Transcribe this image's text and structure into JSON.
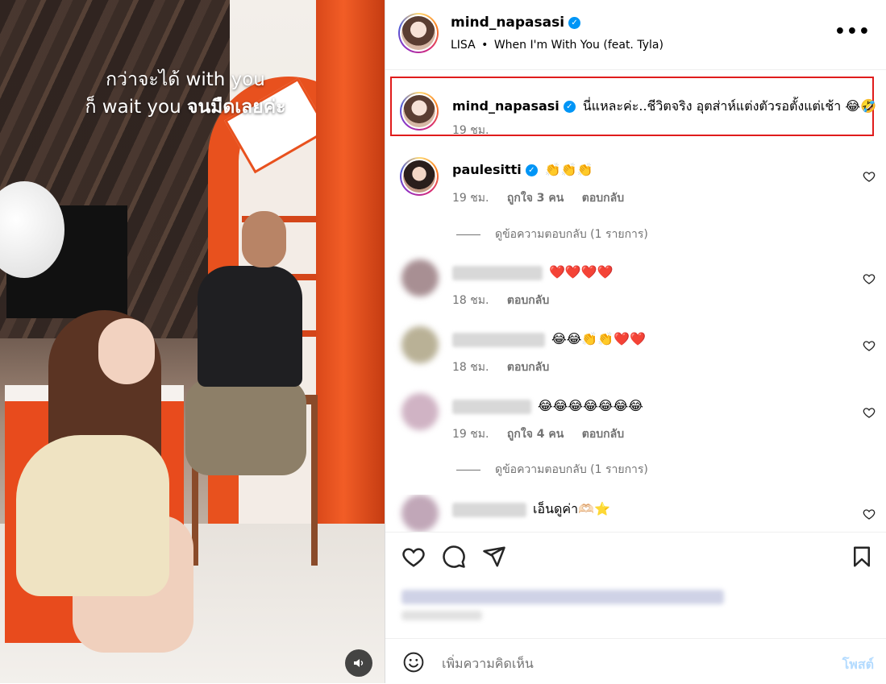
{
  "video": {
    "caption_line1": "กว่าจะได้ with you",
    "caption_line2_a": "ก็ wait you",
    "caption_line2_b": "จนมืดเลยค่ะ",
    "mute_icon": "speaker-icon"
  },
  "header": {
    "username": "mind_napasasi",
    "verified": true,
    "artist": "LISA",
    "separator": "•",
    "song": "When I'm With You (feat. Tyla)",
    "more_label": "•••"
  },
  "caption": {
    "username": "mind_napasasi",
    "text": "นี่แหละค่ะ..ชีวิตจริง อุตส่าห์แต่งตัวรอตั้งแต่เช้า 😂🤣",
    "time": "19 ชม."
  },
  "comments": [
    {
      "username": "paulesitti",
      "verified": true,
      "text": "👏👏👏",
      "time": "19 ชม.",
      "likes": "ถูกใจ 3 คน",
      "reply": "ตอบกลับ",
      "view_replies": "ดูข้อความตอบกลับ (1 รายการ)"
    },
    {
      "username_hidden": true,
      "text": "❤️❤️❤️❤️",
      "time": "18 ชม.",
      "reply": "ตอบกลับ"
    },
    {
      "username_hidden": true,
      "text": "😂😂👏👏❤️❤️",
      "time": "18 ชม.",
      "reply": "ตอบกลับ"
    },
    {
      "username_hidden": true,
      "text": "😂😂😂😂😂😂😂",
      "time": "19 ชม.",
      "likes": "ถูกใจ 4 คน",
      "reply": "ตอบกลับ",
      "view_replies": "ดูข้อความตอบกลับ (1 รายการ)"
    },
    {
      "username_hidden": true,
      "text": "เอ็นดูค่า🫶🏻⭐",
      "time": "",
      "reply": ""
    }
  ],
  "actions": {
    "like_icon": "heart-icon",
    "comment_icon": "comment-icon",
    "share_icon": "share-icon",
    "save_icon": "bookmark-icon"
  },
  "composer": {
    "placeholder": "เพิ่มความคิดเห็น",
    "post_label": "โพสต์",
    "post_color": "#b3dbff"
  },
  "colors": {
    "verified": "#0095f6",
    "highlight_border": "#e01c1c",
    "meta_text": "#737373"
  }
}
